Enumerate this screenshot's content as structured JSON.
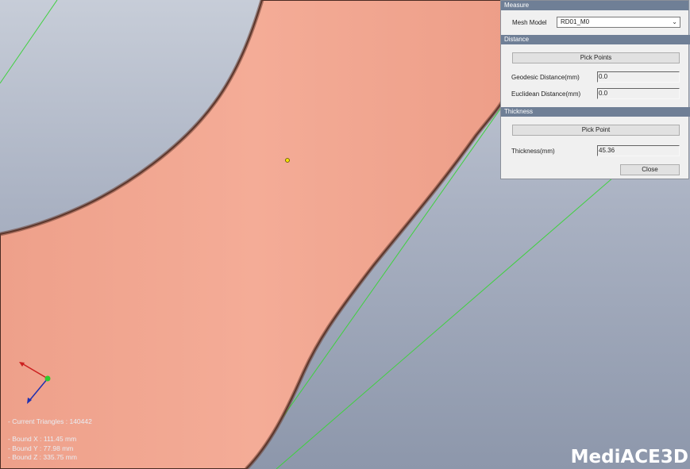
{
  "panel": {
    "title": "Measure",
    "mesh_model_label": "Mesh Model",
    "mesh_model_value": "RD01_M0",
    "distance": {
      "header": "Distance",
      "pick_points_label": "Pick Points",
      "geodesic_label": "Geodesic Distance(mm)",
      "geodesic_value": "0.0",
      "euclidean_label": "Euclidean Distance(mm)",
      "euclidean_value": "0.0"
    },
    "thickness": {
      "header": "Thickness",
      "pick_point_label": "Pick Point",
      "thickness_label": "Thickness(mm)",
      "thickness_value": "45.36",
      "close_label": "Close"
    }
  },
  "viewport": {
    "info": {
      "triangles": "- Current Triangles : 140442",
      "bound_x": "- Bound X : 111.45 mm",
      "bound_y": "- Bound Y : 77.98 mm",
      "bound_z": "- Bound Z : 335.75 mm"
    },
    "logo": "MediACE3D",
    "colors": {
      "mesh": "#f2a893",
      "guide_line": "#3fd13f",
      "axis_x": "#cc2020",
      "axis_y": "#2ecc2e",
      "axis_z": "#1f2fb0"
    }
  }
}
